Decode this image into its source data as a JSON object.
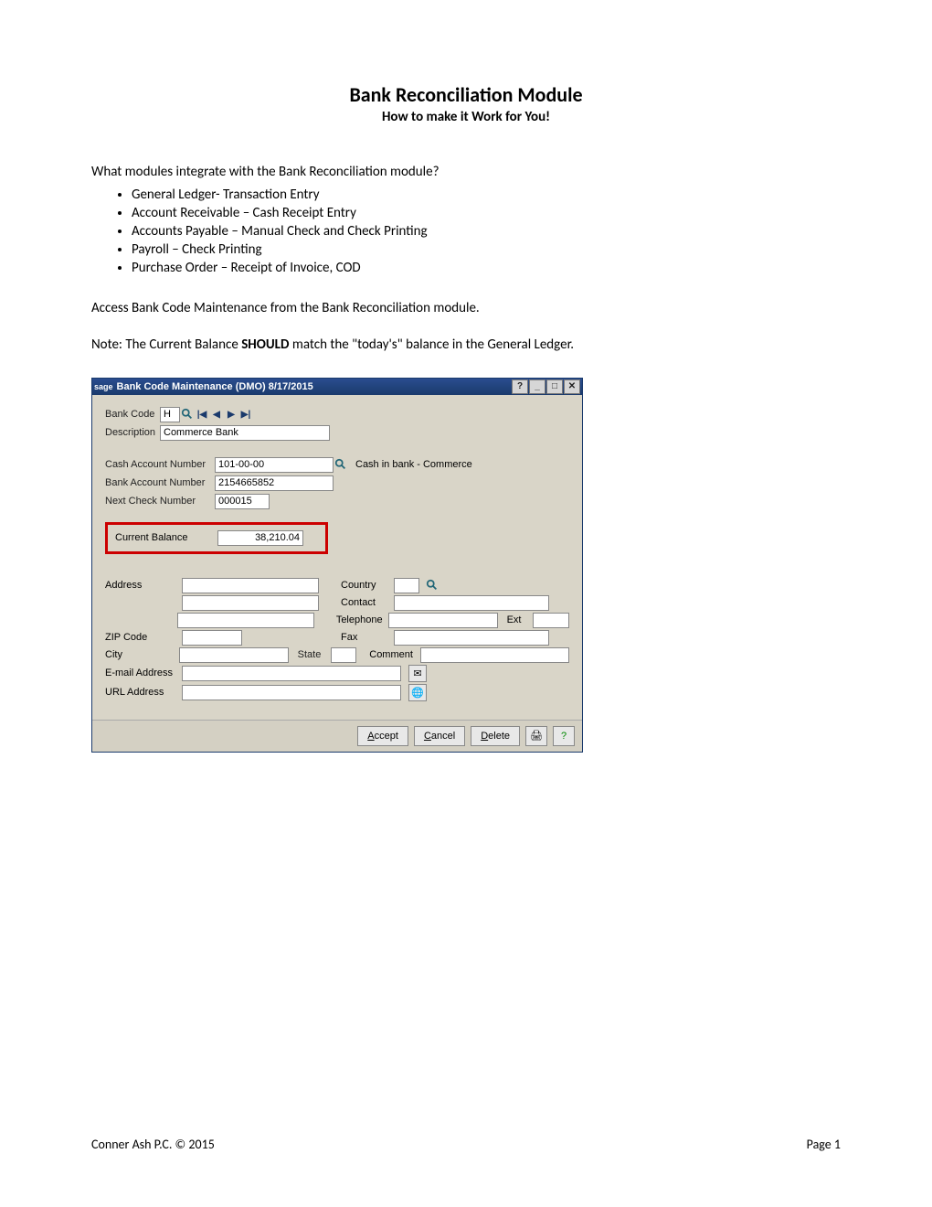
{
  "doc": {
    "title": "Bank Reconciliation Module",
    "subtitle": "How to make it Work for You!",
    "q1": "What modules integrate with the Bank Reconciliation module?",
    "bullets": [
      "General Ledger- Transaction Entry",
      "Account Receivable – Cash Receipt Entry",
      "Accounts Payable – Manual Check and Check Printing",
      "Payroll – Check Printing",
      "Purchase Order – Receipt of Invoice, COD"
    ],
    "p2": "Access Bank Code Maintenance from the Bank Reconciliation module.",
    "note_prefix": "Note:  The Current Balance ",
    "note_bold": "SHOULD",
    "note_suffix": " match the \"today's\" balance in the General Ledger.",
    "footer_left": "Conner Ash P.C. © 2015",
    "footer_right": "Page 1"
  },
  "app": {
    "title": "Bank Code Maintenance (DMO) 8/17/2015",
    "brand": "sage",
    "tb": {
      "help": "?",
      "min": "_",
      "max": "□",
      "close": "✕"
    },
    "labels": {
      "bank_code": "Bank Code",
      "description": "Description",
      "cash_acct": "Cash Account Number",
      "bank_acct": "Bank Account Number",
      "next_check": "Next Check Number",
      "current_balance": "Current Balance",
      "cash_in_bank": "Cash in bank - Commerce",
      "address": "Address",
      "zip": "ZIP Code",
      "city": "City",
      "state": "State",
      "email": "E-mail Address",
      "url": "URL Address",
      "country": "Country",
      "contact": "Contact",
      "telephone": "Telephone",
      "ext": "Ext",
      "fax": "Fax",
      "comment": "Comment"
    },
    "values": {
      "bank_code": "H",
      "description": "Commerce Bank",
      "cash_acct": "101-00-00",
      "bank_acct": "2154665852",
      "next_check": "000015",
      "current_balance": "38,210.04"
    },
    "buttons": {
      "accept": "Accept",
      "cancel": "Cancel",
      "delete": "Delete"
    }
  }
}
